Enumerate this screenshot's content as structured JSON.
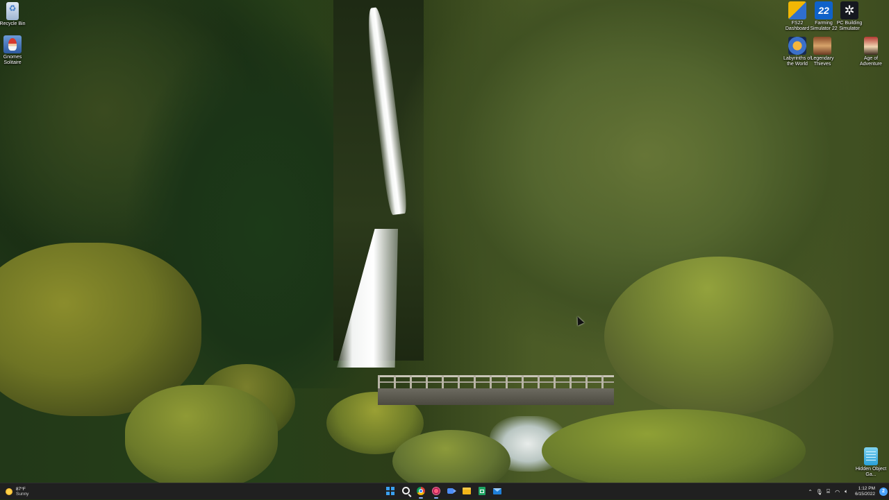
{
  "desktop": {
    "icons_left": [
      {
        "label": "Recycle Bin",
        "icon": "recycle-bin-icon"
      },
      {
        "label": "Gnomes Solitaire",
        "icon": "gnomes-solitaire-icon"
      }
    ],
    "icons_right": [
      {
        "label": "FS22 Dashboard",
        "icon": "fs22-dashboard-icon"
      },
      {
        "label": "Farming Simulator 22",
        "icon": "farming-simulator-22-icon"
      },
      {
        "label": "PC Building Simulator",
        "icon": "pc-building-simulator-icon"
      },
      {
        "label": "Labyrinths of the World",
        "icon": "labyrinths-icon"
      },
      {
        "label": "Legendary Thieves",
        "icon": "thieves-icon"
      },
      {
        "label": "Age of Adventure",
        "icon": "age-of-adventure-icon"
      },
      {
        "label": "Hidden Object Ga...",
        "icon": "hidden-object-icon"
      }
    ]
  },
  "taskbar": {
    "weather": {
      "temp": "87°F",
      "condition": "Sunny",
      "icon": "sun-icon"
    },
    "pinned": [
      {
        "name": "start",
        "icon": "windows-start-icon"
      },
      {
        "name": "search",
        "icon": "search-icon"
      },
      {
        "name": "chrome",
        "icon": "chrome-icon"
      },
      {
        "name": "screen-capture",
        "icon": "screen-capture-icon"
      },
      {
        "name": "meet",
        "icon": "video-meet-icon"
      },
      {
        "name": "file-explorer",
        "icon": "folder-icon"
      },
      {
        "name": "sheets",
        "icon": "spreadsheet-icon"
      },
      {
        "name": "mail",
        "icon": "mail-icon"
      }
    ],
    "tray": {
      "time": "1:12 PM",
      "date": "6/15/2022",
      "notifications": "2"
    }
  },
  "colors": {
    "taskbar_bg": "#202020",
    "accent": "#3aa0f0"
  }
}
